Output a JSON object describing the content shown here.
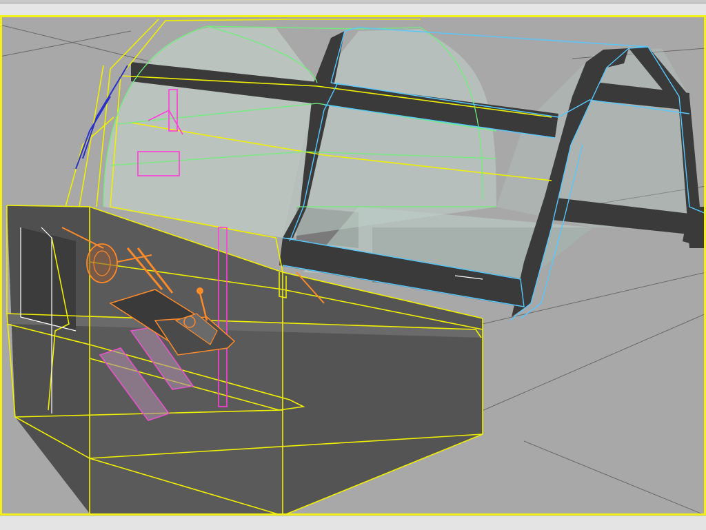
{
  "window": {
    "title": ""
  },
  "viewport": {
    "label": ""
  },
  "colors": {
    "selection_outline": "#f2f21a",
    "viewport_bg": "#a9a9a9",
    "wire_yellow": "#f0f000",
    "wire_cyan": "#55c8ff",
    "wire_green": "#6ff07a",
    "wire_orange": "#ff8a2a",
    "wire_magenta": "#ff3cd8",
    "wire_blue": "#2a30c8",
    "wire_white": "#ffffff"
  }
}
